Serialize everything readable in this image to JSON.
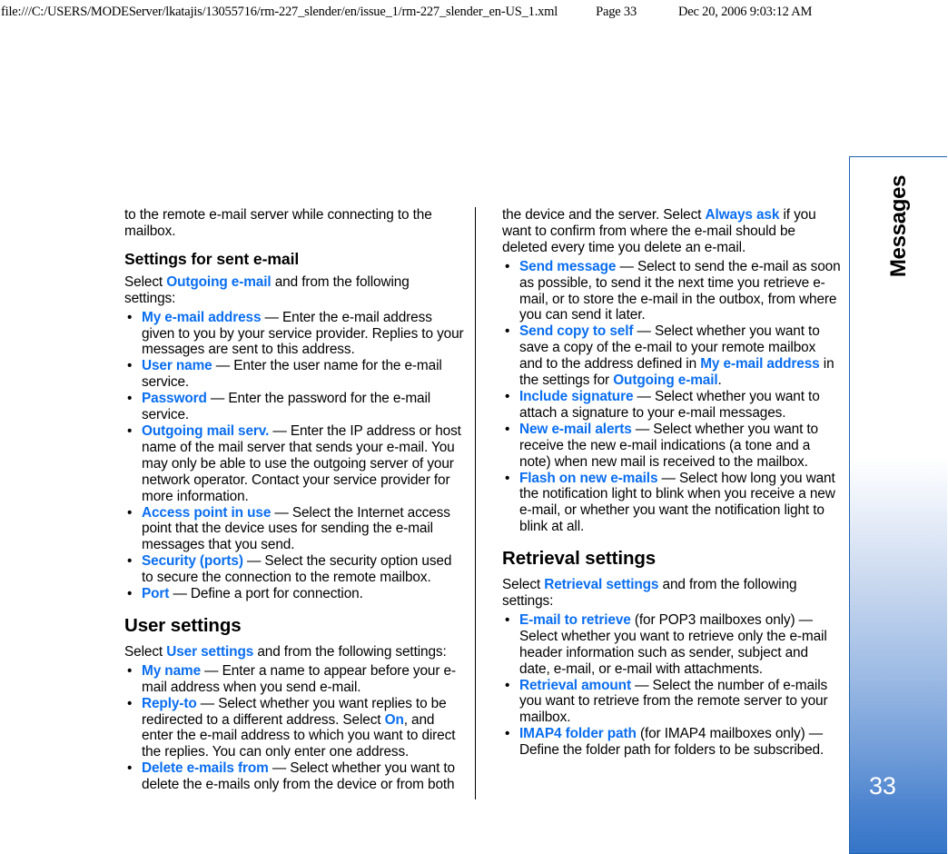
{
  "print_header": {
    "file_path": "file:///C:/USERS/MODEServer/lkatajis/13055716/rm-227_slender/en/issue_1/rm-227_slender_en-US_1.xml",
    "page_label": "Page 33",
    "timestamp": "Dec 20, 2006 9:03:12 AM"
  },
  "side_tab": {
    "chapter_label": "Messages",
    "page_number": "33",
    "accent_color": "#2469bd",
    "border_color": "#1d63b0"
  },
  "colors": {
    "keyword_blue": "#0a6ef0",
    "body_black": "#000000"
  },
  "left_column": {
    "continued_paragraph": {
      "line1": "to the remote e-mail server while connecting to the",
      "line2": "mailbox."
    },
    "heading_sent_email": "Settings for sent e-mail",
    "intro_sent_email": {
      "before": "Select ",
      "keyword": "Outgoing e-mail",
      "after": " and from the following settings:"
    },
    "sent_email_items": [
      {
        "keyword": "My e-mail address",
        "text": " — Enter the e-mail address given to you by your service provider. Replies to your messages are sent to this address."
      },
      {
        "keyword": "User name",
        "text": " — Enter the user name for the e-mail service."
      },
      {
        "keyword": "Password",
        "text": " — Enter the password for the e-mail service."
      },
      {
        "keyword": "Outgoing mail serv.",
        "text": " — Enter the IP address or host name of the mail server that sends your e-mail. You may only be able to use the outgoing server of your network operator. Contact your service provider for more information."
      },
      {
        "keyword": "Access point in use",
        "text": " — Select the Internet access point that the device uses for sending the e-mail messages that you send."
      },
      {
        "keyword": "Security (ports)",
        "text": " — Select the security option used to secure the connection to the remote mailbox."
      },
      {
        "keyword": "Port",
        "text": " — Define a port for connection."
      }
    ],
    "heading_user_settings": "User settings",
    "intro_user_settings": {
      "before": "Select ",
      "keyword": "User settings",
      "after": " and from the following settings:"
    },
    "user_settings_items": [
      {
        "keyword": "My name",
        "text": " — Enter a name to appear before your e-mail address when you send e-mail."
      },
      {
        "keyword": "Reply-to",
        "text_before": " — Select whether you want replies to be redirected to a different address. Select ",
        "inline_keyword": "On",
        "text_after": ", and enter the e-mail address to which you want to direct the replies. You can only enter one address."
      },
      {
        "keyword": "Delete e-mails from",
        "text": " — Select whether you want to delete the e-mails only from the device or from both"
      }
    ]
  },
  "right_column": {
    "continued_paragraph": {
      "before": "the device and the server. Select ",
      "keyword": "Always ask",
      "after": " if you want to confirm from where the e-mail should be deleted every time you delete an e-mail."
    },
    "sent_email_items_continued": [
      {
        "keyword": "Send message",
        "text": " — Select to send the e-mail as soon as possible, to send it the next time you retrieve e-mail, or to store the e-mail in the outbox, from where you can send it later."
      },
      {
        "keyword": "Send copy to self",
        "text_before": " — Select whether you want to save a copy of the e-mail to your remote mailbox and to the address defined in ",
        "inline_keyword_1": "My e-mail address",
        "text_middle": " in the settings for ",
        "inline_keyword_2": "Outgoing e-mail",
        "text_after": "."
      },
      {
        "keyword": "Include signature",
        "text": " — Select whether you want to attach a signature to your e-mail messages."
      },
      {
        "keyword": "New e-mail alerts",
        "text": " — Select whether you want to receive the new e-mail indications (a tone and a note) when new mail is received to the mailbox."
      },
      {
        "keyword": "Flash on new e-mails",
        "text": " — Select how long you want the notification light to blink when you receive a new e-mail, or whether you want the notification light to blink at all."
      }
    ],
    "heading_retrieval": "Retrieval settings",
    "intro_retrieval": {
      "before": "Select ",
      "keyword": "Retrieval settings",
      "after": " and from the following settings:"
    },
    "retrieval_items": [
      {
        "keyword": "E-mail to retrieve",
        "text": " (for POP3 mailboxes only) — Select whether you want to retrieve only the e-mail header information such as sender, subject and date, e-mail, or e-mail with attachments."
      },
      {
        "keyword": "Retrieval amount",
        "text": " — Select the number of e-mails you want to retrieve from the remote server to your mailbox."
      },
      {
        "keyword": "IMAP4 folder path",
        "text": " (for IMAP4 mailboxes only) — Define the folder path for folders to be subscribed."
      }
    ]
  }
}
